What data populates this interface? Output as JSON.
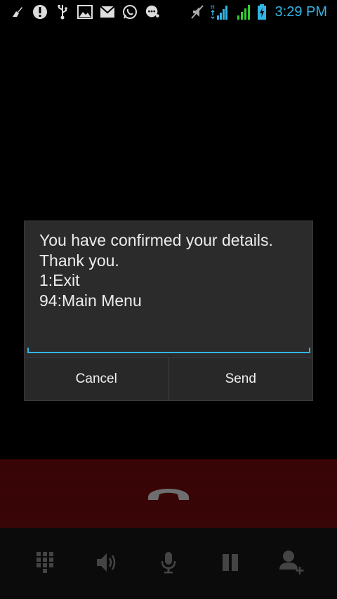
{
  "status_bar": {
    "time": "3:29 PM",
    "left_icons": [
      "broom-icon",
      "alert-icon",
      "usb-icon",
      "image-icon",
      "mail-icon",
      "whatsapp-icon",
      "chat-bubble-icon"
    ],
    "right_icons": [
      "mute-icon",
      "signal-h-icon",
      "signal-icon",
      "battery-charging-icon"
    ],
    "time_color": "#33b5e5"
  },
  "dialog": {
    "message_lines": [
      "You have confirmed your details.",
      "Thank you.",
      "1:Exit",
      "94:Main Menu"
    ],
    "cancel_label": "Cancel",
    "send_label": "Send",
    "accent_color": "#33b5e5"
  },
  "call": {
    "end_call_icon": "end-call-icon",
    "end_bar_color": "#3a0506"
  },
  "controls": [
    "dialpad-icon",
    "speaker-icon",
    "mute-mic-icon",
    "hold-icon",
    "add-call-icon"
  ]
}
